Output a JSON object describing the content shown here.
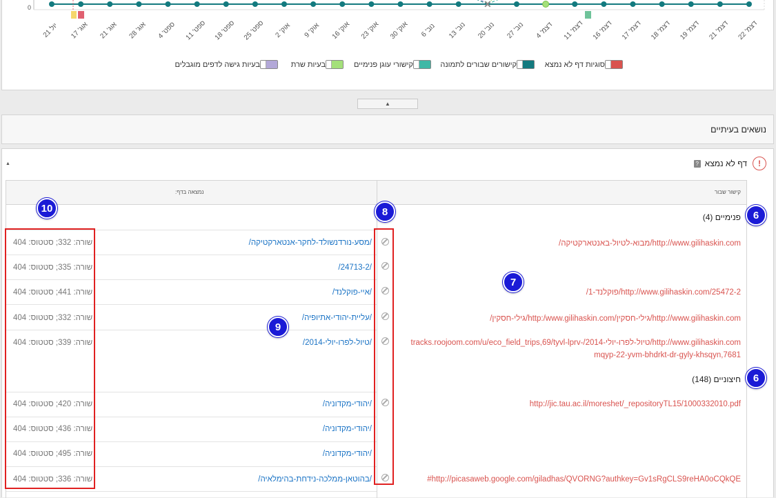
{
  "chart": {
    "y_zero_label": "0",
    "x_labels": [
      "יול 21",
      "אוג' 17",
      "אוג' 21",
      "אוג' 28",
      "ספט' 4",
      "ספט' 11",
      "ספט' 18",
      "ספט' 25",
      "אוק' 2",
      "אוק' 9",
      "אוק' 16",
      "אוק' 23",
      "אוק' 30",
      "נוב' 6",
      "נוב' 13",
      "נוב' 20",
      "נוב' 27",
      "דצמ' 4",
      "דצמ' 11",
      "דצמ' 16",
      "דצמ' 17",
      "דצמ' 18",
      "דצמ' 19",
      "דצמ' 21",
      "דצמ' 22"
    ],
    "legend": [
      {
        "label": "סוגיות דף לא נמצא",
        "color": "#d9534f"
      },
      {
        "label": "קישורים שבורים לתמונה",
        "color": "#137a7f"
      },
      {
        "label": "קישורי עוגן פנימיים",
        "color": "#3fb8a6"
      },
      {
        "label": "בעיות שרת",
        "color": "#a4e07a"
      },
      {
        "label": "בעיות גישה לדפים מוגבלים",
        "color": "#b3a8d8"
      }
    ]
  },
  "collapse_icon": "caret-up-icon",
  "issues_section": {
    "title": "נושאים בעיתיים"
  },
  "issue": {
    "label": "דף לא נמצא",
    "col_broken": "קישור שבור",
    "col_found": "נמצאה בדף:",
    "groups": {
      "internal": "פנימיים (4)",
      "external": "חיצוניים (148)"
    },
    "rows": [
      {
        "broken": "http://www.gilihaskin.com/מבוא-לטיול-באנטארקטיקה/",
        "found": "/מסע-נורדנשולד-לחקר-אנטארקטיקה/",
        "status": "שורה: 332; סטטוס: 404"
      },
      {
        "broken": "http://www.gilihaskin.com/25472-2/פוקלנד-1/",
        "found": "/24713-2/",
        "status": "שורה: 335; סטטוס: 404"
      },
      {
        "broken": "http://www.gilihaskin.com/גילי-חסקין/http:/www.gilihaskin.com/גילי-חסקין/",
        "found": "/איי-פוקלנד/",
        "status": "שורה: 441; סטטוס: 404"
      },
      {
        "broken": "http://www.gilihaskin.com/טיול-לפרו-יולי-2014/tracks.roojoom.com/u/eco_field_trips,69/tyvl-lprv-mqyp-22-yvm-bhdrkt-dr-gyly-khsqyn,7681",
        "found": "/עליית-יהודי-אתיופיה/",
        "status": "שורה: 332; סטטוס: 404"
      },
      {
        "broken": "",
        "found": "/טיול-לפרו-יולי-2014/",
        "status": "שורה: 339; סטטוס: 404"
      },
      {
        "broken": "http://jic.tau.ac.il/moreshet/_repositoryTL15/1000332010.pdf",
        "found": "/יהודי-מקדוניה/",
        "status": "שורה: 420; סטטוס: 404"
      },
      {
        "broken": "",
        "found": "/יהודי-מקדוניה/",
        "status": "שורה: 436; סטטוס: 404"
      },
      {
        "broken": "",
        "found": "/יהודי-מקדוניה/",
        "status": "שורה: 495; סטטוס: 404"
      },
      {
        "broken": "http://picasaweb.google.com/giladhas/QVORNG?authkey=Gv1sRgCLS9reHA0oCQkQE#",
        "found": "/בהוטאן-ממלכה-נידחת-בהימלאיה/",
        "status": "שורה: 336; סטטוס: 404"
      }
    ]
  },
  "markers": [
    "6",
    "7",
    "8",
    "9",
    "10",
    "6"
  ]
}
